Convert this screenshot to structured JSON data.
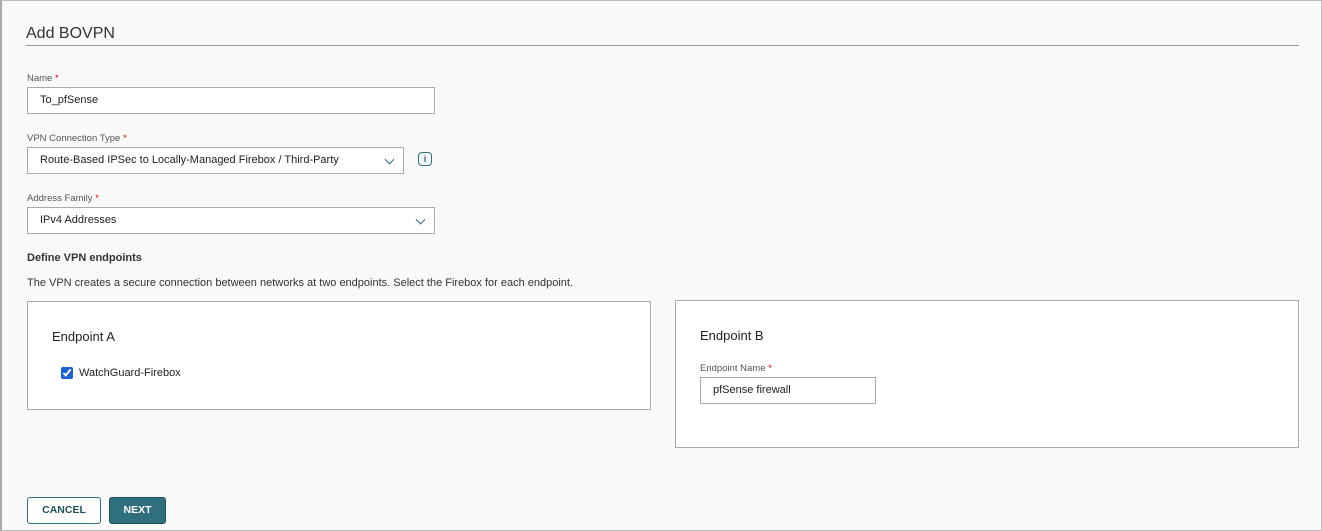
{
  "title": "Add BOVPN",
  "name": {
    "label": "Name",
    "required": "*",
    "value": "To_pfSense"
  },
  "connection_type": {
    "label": "VPN Connection Type",
    "required": "*",
    "value": "Route-Based IPSec to Locally-Managed Firebox / Third-Party"
  },
  "address_family": {
    "label": "Address Family",
    "required": "*",
    "value": "IPv4 Addresses"
  },
  "endpoints": {
    "heading": "Define VPN endpoints",
    "description": "The VPN creates a secure connection between networks at two endpoints. Select the Firebox for each endpoint.",
    "a": {
      "title": "Endpoint A",
      "checkbox_label": "WatchGuard-Firebox",
      "checked": true
    },
    "b": {
      "title": "Endpoint B",
      "field_label": "Endpoint Name",
      "required": "*",
      "value": "pfSense firewall"
    }
  },
  "buttons": {
    "cancel": "CANCEL",
    "next": "NEXT"
  },
  "colors": {
    "accent": "#2f6f7e",
    "required": "#dd0000"
  }
}
